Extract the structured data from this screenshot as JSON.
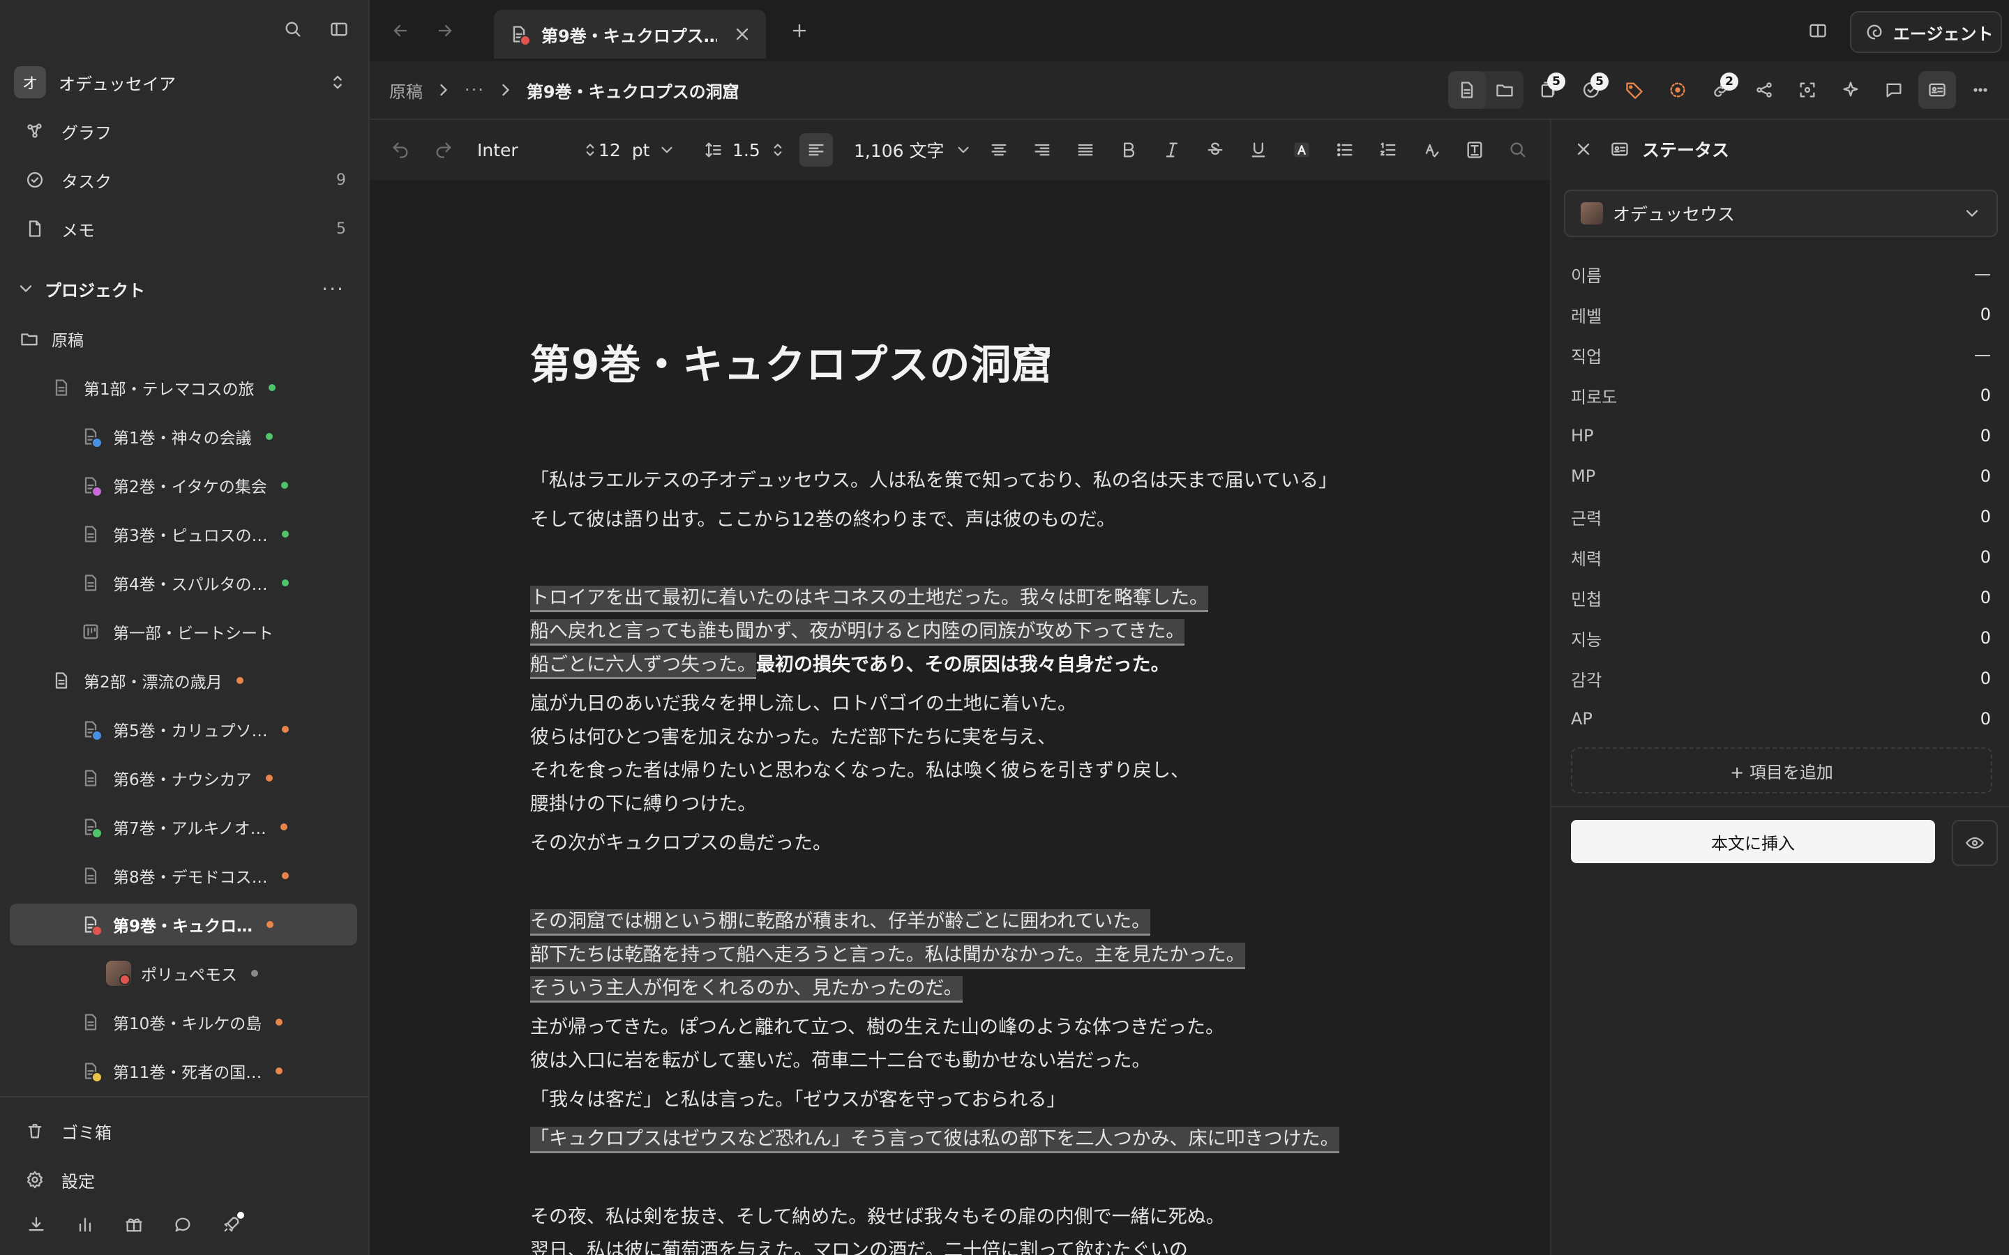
{
  "sidebar": {
    "workspace": {
      "badge": "オ",
      "name": "オデュッセイア"
    },
    "nav": [
      {
        "label": "グラフ",
        "count": ""
      },
      {
        "label": "タスク",
        "count": "9"
      },
      {
        "label": "メモ",
        "count": "5"
      }
    ],
    "projects_label": "プロジェクト",
    "projects_more": "···",
    "tree": [
      {
        "label": "原稿"
      },
      {
        "label": "第1部・テレマコスの旅",
        "dot": "#4fc46b"
      },
      {
        "label": "第1巻・神々の会議",
        "dot": "#4fc46b",
        "sub": "#4a90e2"
      },
      {
        "label": "第2巻・イタケの集会",
        "dot": "#4fc46b",
        "sub": "#c86bd8"
      },
      {
        "label": "第3巻・ピュロスの…",
        "dot": "#4fc46b"
      },
      {
        "label": "第4巻・スパルタの…",
        "dot": "#4fc46b"
      },
      {
        "label": "第一部・ビートシート"
      },
      {
        "label": "第2部・漂流の歳月",
        "dot": "#e8854a"
      },
      {
        "label": "第5巻・カリュプソ…",
        "dot": "#e8854a",
        "sub": "#4a90e2"
      },
      {
        "label": "第6巻・ナウシカア",
        "dot": "#e8854a"
      },
      {
        "label": "第7巻・アルキノオ…",
        "dot": "#e8854a",
        "sub": "#4fc46b"
      },
      {
        "label": "第8巻・デモドコス…",
        "dot": "#e8854a"
      },
      {
        "label": "第9巻・キュクロ…",
        "dot": "#e8854a",
        "sub": "#e0564f"
      },
      {
        "label": "ポリュペモス",
        "dot": "#8a8a8a"
      },
      {
        "label": "第10巻・キルケの島",
        "dot": "#e8854a"
      },
      {
        "label": "第11巻・死者の国…",
        "dot": "#e8854a",
        "sub": "#e8c24a"
      }
    ],
    "trash": "ゴミ箱",
    "settings": "設定"
  },
  "tabs": {
    "active": "第9巻・キュクロプス…",
    "agent": "エージェント"
  },
  "breadcrumb": {
    "root": "原稿",
    "ellipsis": "···",
    "current": "第9巻・キュクロプスの洞窟"
  },
  "toolbar_badges": {
    "docs": "5",
    "tasks": "5",
    "links": "2"
  },
  "format": {
    "font": "Inter",
    "size": "12",
    "unit": "pt",
    "line_height": "1.5",
    "word_count": "1,106 文字"
  },
  "doc": {
    "title": "第9巻・キュクロプスの洞窟",
    "lines": [
      "「私はラエルテスの子オデュッセウス。人は私を策で知っており、私の名は天まで届いている」",
      "そして彼は語り出す。ここから12巻の終わりまで、声は彼のものだ。",
      "トロイアを出て最初に着いたのはキコネスの土地だった。我々は町を略奪した。",
      "船へ戻れと言っても誰も聞かず、夜が明けると内陸の同族が攻め下ってきた。",
      "船ごとに六人ずつ失った。",
      "最初の損失であり、その原因は我々自身だった。",
      "嵐が九日のあいだ我々を押し流し、ロトパゴイの土地に着いた。",
      "彼らは何ひとつ害を加えなかった。ただ部下たちに実を与え、",
      "それを食った者は帰りたいと思わなくなった。私は喚く彼らを引きずり戻し、",
      "腰掛けの下に縛りつけた。",
      "その次がキュクロプスの島だった。",
      "その洞窟では棚という棚に乾酪が積まれ、仔羊が齢ごとに囲われていた。",
      "部下たちは乾酪を持って船へ走ろうと言った。私は聞かなかった。主を見たかった。",
      "そういう主人が何をくれるのか、見たかったのだ。",
      "主が帰ってきた。ぽつんと離れて立つ、樹の生えた山の峰のような体つきだった。",
      "彼は入口に岩を転がして塞いだ。荷車二十二台でも動かせない岩だった。",
      "「我々は客だ」と私は言った。「ゼウスが客を守っておられる」",
      "「キュクロプスはゼウスなど恐れん」そう言って彼は私の部下を二人つかみ、床に叩きつけた。",
      "その夜、私は剣を抜き、そして納めた。殺せば我々もその扉の内側で一緒に死ぬ。",
      "翌日、私は彼に葡萄酒を与えた。マロンの酒だ。二十倍に割って飲むたぐいの"
    ]
  },
  "panel": {
    "title": "ステータス",
    "character": "オデュッセウス",
    "stats": [
      {
        "key": "이름",
        "value": "—"
      },
      {
        "key": "레벨",
        "value": "0"
      },
      {
        "key": "직업",
        "value": "—"
      },
      {
        "key": "피로도",
        "value": "0"
      },
      {
        "key": "HP",
        "value": "0"
      },
      {
        "key": "MP",
        "value": "0"
      },
      {
        "key": "근력",
        "value": "0"
      },
      {
        "key": "체력",
        "value": "0"
      },
      {
        "key": "민첩",
        "value": "0"
      },
      {
        "key": "지능",
        "value": "0"
      },
      {
        "key": "감각",
        "value": "0"
      },
      {
        "key": "AP",
        "value": "0"
      }
    ],
    "add_item": "+ 項目を追加",
    "insert": "本文に挿入"
  }
}
